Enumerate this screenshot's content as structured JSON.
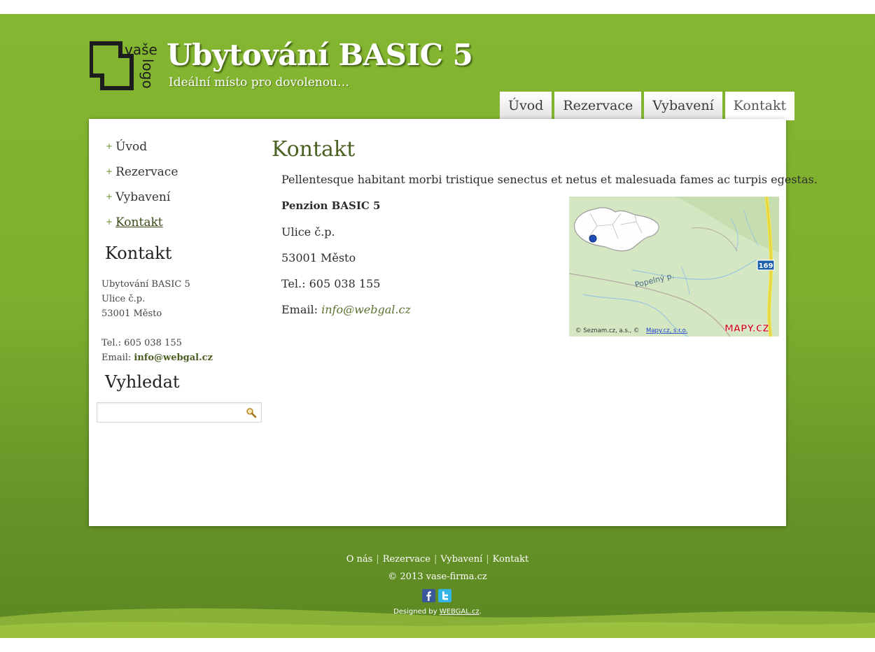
{
  "header": {
    "logo_text_top": "vaše",
    "logo_text_side": "logo",
    "title": "Ubytování BASIC 5",
    "tagline": "Ideální místo pro dovolenou…"
  },
  "tabs": [
    {
      "label": "Úvod"
    },
    {
      "label": "Rezervace"
    },
    {
      "label": "Vybavení"
    },
    {
      "label": "Kontakt",
      "active": true
    }
  ],
  "sidebar": {
    "nav": [
      {
        "label": "Úvod"
      },
      {
        "label": "Rezervace"
      },
      {
        "label": "Vybavení"
      },
      {
        "label": "Kontakt",
        "active": true
      }
    ],
    "contact_heading": "Kontakt",
    "contact": {
      "name": "Ubytování BASIC 5",
      "street": "Ulice č.p.",
      "city": "53001 Město",
      "tel": "Tel.: 605 038 155",
      "email_label": "Email:",
      "email": "info@webgal.cz"
    },
    "search_heading": "Vyhledat",
    "search_placeholder": ""
  },
  "content": {
    "title": "Kontakt",
    "intro": "Pellentesque habitant morbi tristique senectus et netus et malesuada fames ac turpis egestas.",
    "name": "Penzion BASIC 5",
    "street": "Ulice č.p.",
    "city": "53001 Město",
    "tel": "Tel.: 605 038 155",
    "email_label": "Email:",
    "email": "info@webgal.cz"
  },
  "map": {
    "river_label": "Popelný p.",
    "road_number": "169",
    "attribution_prefix": "© Seznam.cz, a.s., ©",
    "attribution_link": "Mapy.cz, s.r.o.",
    "brand": "MAPY.CZ"
  },
  "footer": {
    "links": [
      {
        "label": "O nás"
      },
      {
        "label": "Rezervace"
      },
      {
        "label": "Vybavení"
      },
      {
        "label": "Kontakt"
      }
    ],
    "copyright": "© 2013 vase-firma.cz",
    "designed_prefix": "Designed by",
    "designed_link": "WEBGAL.cz",
    "designed_suffix": "."
  },
  "colors": {
    "background_green": "#7db02f",
    "title_green": "#4b6122",
    "facebook": "#3b5998",
    "twitter": "#33b5e5"
  },
  "icons": {
    "search": "magnifier-icon",
    "facebook": "facebook-icon",
    "twitter": "twitter-icon"
  }
}
